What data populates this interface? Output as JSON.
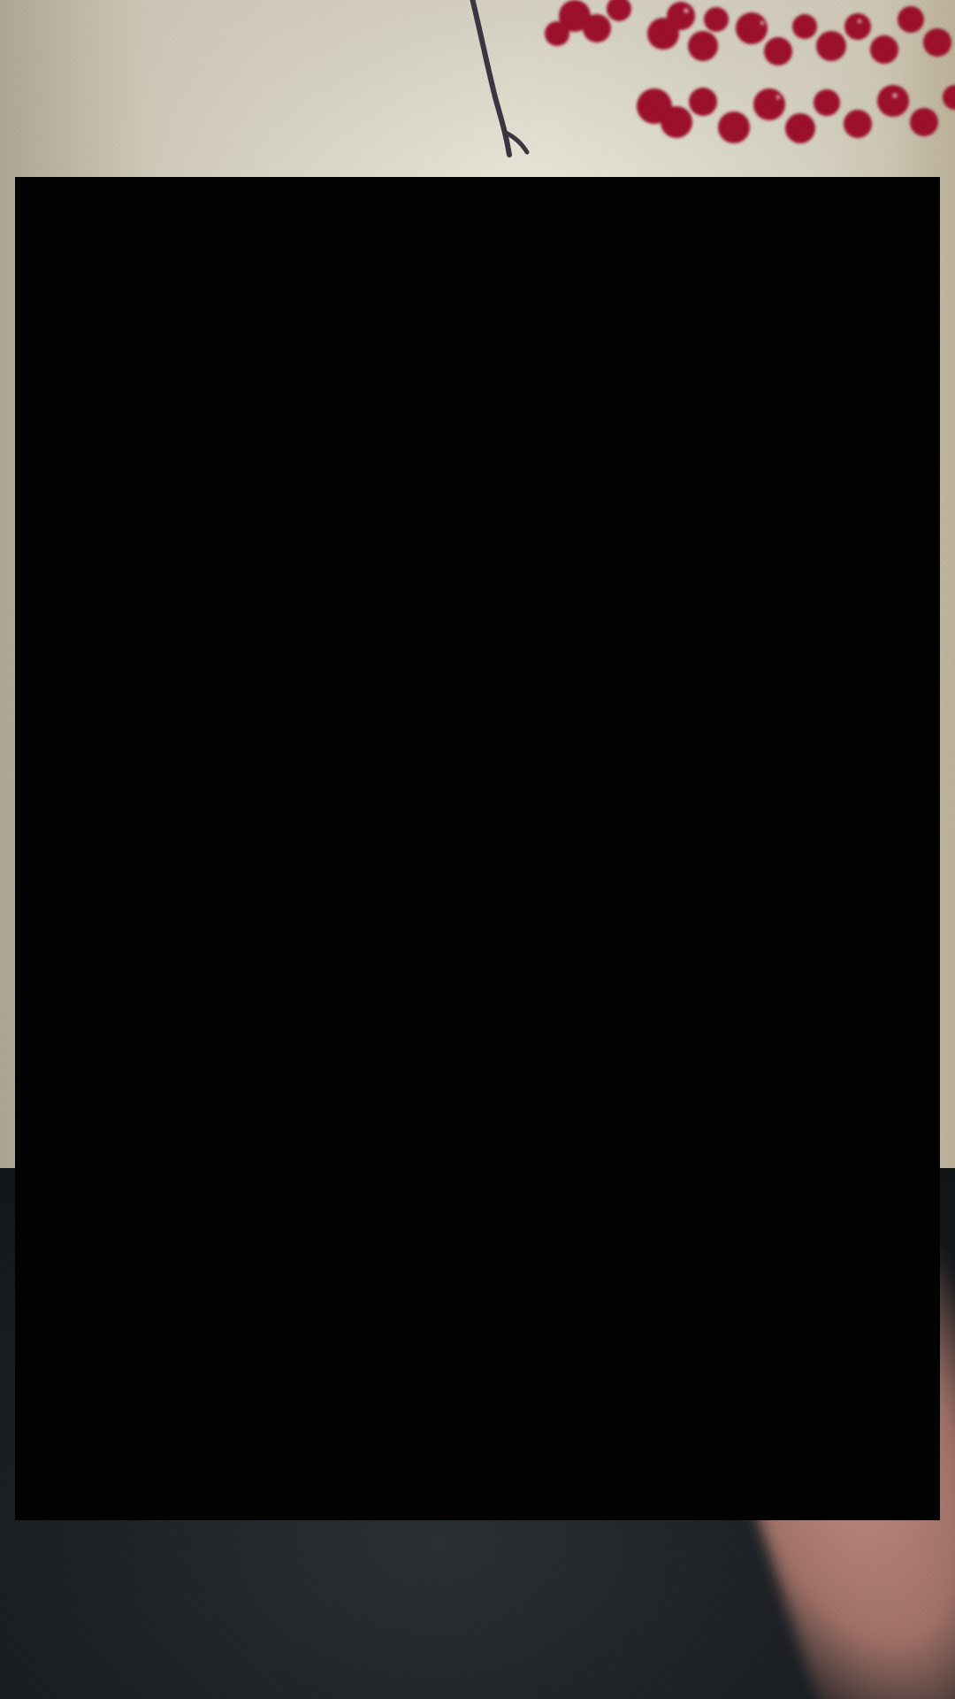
{
  "screen": {
    "description_tags": [
      "camera-preview",
      "blurred-background"
    ],
    "accent_colors": {
      "black_overlay": "#000000",
      "berries": "#9b0f2a",
      "wall": "#d8d4c4",
      "dark_clothing": "#1a1e22",
      "skin": "#b07d72"
    }
  }
}
